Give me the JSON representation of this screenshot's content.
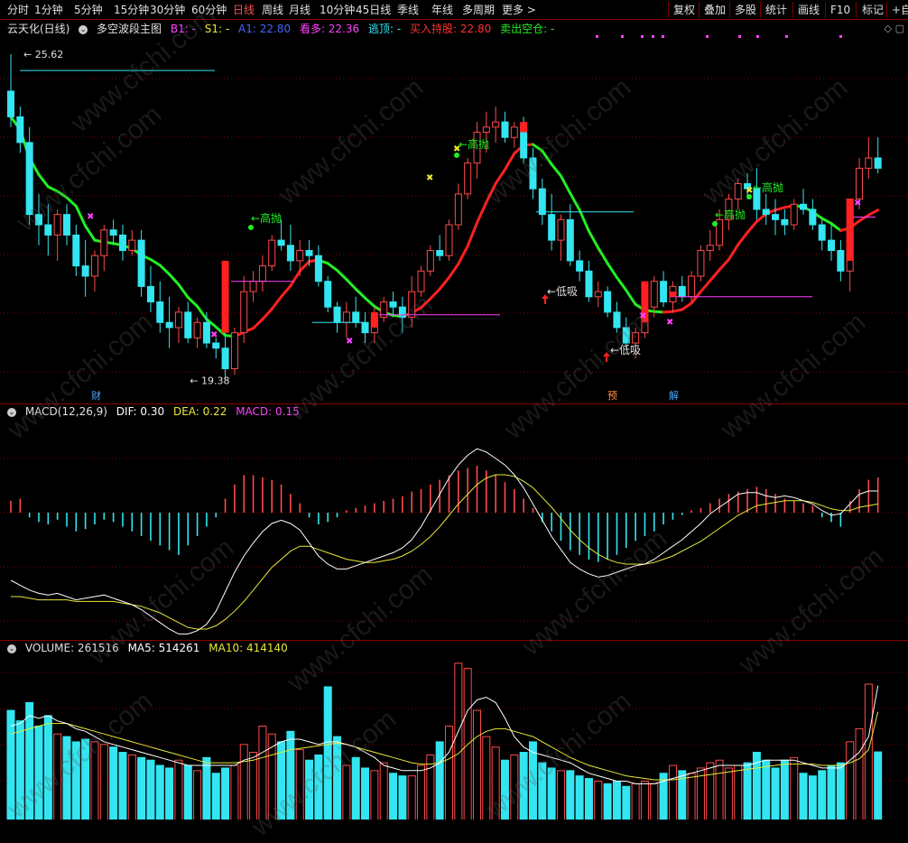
{
  "toolbar": {
    "periods": [
      "分时",
      "1分钟",
      "5分钟",
      "15分钟",
      "30分钟",
      "60分钟",
      "日线",
      "周线",
      "月线",
      "10分钟",
      "45日线",
      "季线",
      "年线",
      "多周期",
      "更多 >"
    ],
    "active_period": "日线",
    "tools": [
      "复权",
      "叠加",
      "多股",
      "统计",
      "画线",
      "F10",
      "标记",
      "+自选"
    ]
  },
  "main_header": {
    "title": "云天化(日线)",
    "indicator": "多空波段主图",
    "b1_label": "B1: -",
    "s1_label": "S1: -",
    "a1_label": "A1: 22.80",
    "kanduo_label": "看多: 22.36",
    "taoding_label": "逃顶: -",
    "buy_hold_label": "买入持股: 22.80",
    "sell_cash_label": "卖出空仓: -"
  },
  "price_labels": {
    "high": "25.62",
    "low": "19.38",
    "gaopao_1": "高抛",
    "gaopao_2": "高抛",
    "gaopao_3": "高抛",
    "gaopao_4": "高抛",
    "dixi_1": "低吸",
    "dixi_2": "低吸"
  },
  "event_markers": [
    "财",
    "预",
    "解"
  ],
  "macd_header": {
    "name": "MACD(12,26,9)",
    "dif": "DIF: 0.30",
    "dea": "DEA: 0.22",
    "macd": "MACD: 0.15"
  },
  "volume_header": {
    "name": "VOLUME: 261516",
    "ma5": "MA5: 514261",
    "ma10": "MA10: 414140"
  },
  "watermark": "www.cfchi.com",
  "colors": {
    "up": "#ff4a4a",
    "down": "#33e5f0",
    "ma_green": "#22ee22",
    "ma_red": "#ff2020",
    "dif": "#ffffff",
    "dea": "#e8e838",
    "macd_label": "#ff40ff",
    "grid": "#7a0000",
    "toolbar_active": "#ff5050"
  },
  "candles": [
    [
      24.9,
      25.62,
      24.2,
      24.4
    ],
    [
      24.4,
      24.6,
      23.7,
      23.9
    ],
    [
      23.9,
      24.2,
      22.3,
      22.5
    ],
    [
      22.5,
      22.9,
      21.9,
      22.3
    ],
    [
      22.3,
      22.7,
      21.7,
      22.1
    ],
    [
      22.1,
      22.6,
      21.6,
      22.5
    ],
    [
      22.5,
      22.7,
      21.9,
      22.1
    ],
    [
      22.1,
      22.3,
      21.3,
      21.5
    ],
    [
      21.5,
      22.0,
      20.9,
      21.3
    ],
    [
      21.3,
      21.8,
      21.0,
      21.7
    ],
    [
      21.7,
      22.3,
      21.4,
      22.2
    ],
    [
      22.2,
      22.4,
      21.9,
      22.1
    ],
    [
      22.1,
      22.3,
      21.6,
      21.8
    ],
    [
      21.8,
      22.2,
      21.7,
      22.0
    ],
    [
      22.0,
      22.2,
      20.9,
      21.1
    ],
    [
      21.1,
      21.5,
      20.6,
      20.8
    ],
    [
      20.8,
      21.2,
      20.2,
      20.4
    ],
    [
      20.4,
      20.9,
      19.9,
      20.3
    ],
    [
      20.3,
      20.7,
      20.0,
      20.6
    ],
    [
      20.6,
      20.8,
      20.0,
      20.1
    ],
    [
      20.1,
      20.5,
      19.9,
      20.4
    ],
    [
      20.4,
      20.6,
      19.9,
      20.0
    ],
    [
      20.0,
      20.1,
      19.7,
      19.9
    ],
    [
      19.9,
      20.2,
      19.3,
      19.5
    ],
    [
      19.5,
      20.3,
      19.38,
      20.2
    ],
    [
      20.2,
      21.3,
      20.0,
      21.0
    ],
    [
      21.0,
      21.4,
      20.8,
      21.2
    ],
    [
      21.2,
      21.7,
      21.0,
      21.5
    ],
    [
      21.5,
      22.1,
      21.4,
      22.0
    ],
    [
      22.0,
      22.4,
      21.8,
      21.9
    ],
    [
      21.9,
      22.3,
      21.4,
      21.6
    ],
    [
      21.6,
      22.0,
      21.3,
      21.8
    ],
    [
      21.8,
      22.0,
      21.5,
      21.7
    ],
    [
      21.7,
      21.9,
      21.1,
      21.2
    ],
    [
      21.2,
      21.3,
      20.6,
      20.7
    ],
    [
      20.7,
      20.8,
      20.2,
      20.4
    ],
    [
      20.4,
      20.8,
      20.1,
      20.6
    ],
    [
      20.6,
      20.9,
      20.3,
      20.4
    ],
    [
      20.4,
      20.6,
      20.0,
      20.2
    ],
    [
      20.2,
      20.7,
      20.0,
      20.5
    ],
    [
      20.5,
      20.9,
      20.4,
      20.8
    ],
    [
      20.8,
      21.0,
      20.5,
      20.7
    ],
    [
      20.7,
      20.9,
      20.2,
      20.5
    ],
    [
      20.5,
      21.3,
      20.3,
      21.0
    ],
    [
      21.0,
      21.5,
      20.9,
      21.4
    ],
    [
      21.4,
      21.9,
      21.3,
      21.8
    ],
    [
      21.8,
      22.1,
      21.6,
      21.7
    ],
    [
      21.7,
      22.4,
      21.6,
      22.3
    ],
    [
      22.3,
      23.1,
      22.2,
      22.9
    ],
    [
      22.9,
      23.6,
      22.8,
      23.5
    ],
    [
      23.5,
      24.3,
      23.2,
      24.1
    ],
    [
      24.1,
      24.5,
      23.7,
      24.2
    ],
    [
      24.2,
      24.6,
      23.9,
      24.3
    ],
    [
      24.3,
      24.5,
      23.9,
      24.0
    ],
    [
      24.0,
      24.3,
      23.8,
      24.2
    ],
    [
      24.2,
      24.4,
      23.5,
      23.6
    ],
    [
      23.6,
      23.8,
      22.8,
      23.0
    ],
    [
      23.0,
      23.2,
      22.3,
      22.5
    ],
    [
      22.5,
      22.9,
      21.8,
      22.0
    ],
    [
      22.0,
      22.5,
      21.6,
      22.4
    ],
    [
      22.4,
      22.7,
      21.5,
      21.6
    ],
    [
      21.6,
      21.8,
      21.2,
      21.4
    ],
    [
      21.4,
      21.6,
      20.8,
      20.9
    ],
    [
      20.9,
      21.2,
      20.7,
      21.0
    ],
    [
      21.0,
      21.1,
      20.5,
      20.6
    ],
    [
      20.6,
      20.8,
      20.2,
      20.3
    ],
    [
      20.3,
      20.5,
      19.9,
      20.0
    ],
    [
      20.0,
      20.3,
      19.7,
      20.2
    ],
    [
      20.2,
      20.8,
      20.1,
      20.7
    ],
    [
      20.7,
      21.3,
      20.5,
      21.2
    ],
    [
      21.2,
      21.4,
      20.7,
      20.8
    ],
    [
      20.8,
      21.2,
      20.6,
      21.1
    ],
    [
      21.1,
      21.3,
      20.8,
      20.9
    ],
    [
      20.9,
      21.4,
      20.8,
      21.3
    ],
    [
      21.3,
      21.9,
      21.2,
      21.8
    ],
    [
      21.8,
      22.2,
      21.6,
      21.9
    ],
    [
      21.9,
      22.6,
      21.8,
      22.4
    ],
    [
      22.4,
      22.9,
      22.2,
      22.8
    ],
    [
      22.8,
      23.2,
      22.6,
      23.1
    ],
    [
      23.1,
      23.3,
      22.8,
      23.0
    ],
    [
      23.0,
      23.4,
      22.4,
      22.6
    ],
    [
      22.6,
      22.9,
      22.3,
      22.5
    ],
    [
      22.5,
      22.8,
      22.1,
      22.4
    ],
    [
      22.4,
      22.6,
      22.1,
      22.3
    ],
    [
      22.3,
      22.8,
      22.2,
      22.7
    ],
    [
      22.7,
      23.0,
      22.5,
      22.6
    ],
    [
      22.6,
      22.8,
      22.2,
      22.3
    ],
    [
      22.3,
      22.4,
      21.8,
      22.0
    ],
    [
      22.0,
      22.3,
      21.6,
      21.8
    ],
    [
      21.8,
      22.0,
      21.2,
      21.4
    ],
    [
      21.4,
      22.8,
      21.0,
      22.8
    ],
    [
      22.8,
      23.6,
      22.6,
      23.4
    ],
    [
      23.4,
      24.0,
      23.2,
      23.6
    ],
    [
      23.6,
      24.0,
      23.3,
      23.4
    ]
  ],
  "macd_bars": [
    0.05,
    0.06,
    -0.02,
    -0.04,
    -0.05,
    -0.03,
    -0.06,
    -0.08,
    -0.07,
    -0.05,
    -0.03,
    -0.04,
    -0.06,
    -0.08,
    -0.1,
    -0.12,
    -0.14,
    -0.16,
    -0.18,
    -0.14,
    -0.1,
    -0.06,
    -0.02,
    0.06,
    0.12,
    0.16,
    0.16,
    0.15,
    0.14,
    0.12,
    0.08,
    0.04,
    -0.02,
    -0.05,
    -0.04,
    -0.02,
    0.01,
    0.02,
    0.03,
    0.04,
    0.05,
    0.06,
    0.07,
    0.09,
    0.1,
    0.12,
    0.14,
    0.16,
    0.18,
    0.19,
    0.2,
    0.18,
    0.16,
    0.13,
    0.1,
    0.06,
    0.02,
    -0.04,
    -0.08,
    -0.12,
    -0.16,
    -0.18,
    -0.2,
    -0.21,
    -0.2,
    -0.18,
    -0.15,
    -0.12,
    -0.1,
    -0.08,
    -0.05,
    -0.03,
    -0.01,
    0.01,
    0.02,
    0.04,
    0.06,
    0.08,
    0.09,
    0.1,
    0.11,
    0.1,
    0.08,
    0.06,
    0.05,
    0.04,
    0.03,
    -0.02,
    -0.04,
    -0.06,
    0.05,
    0.1,
    0.14,
    0.15
  ],
  "dif": [
    -0.25,
    -0.28,
    -0.31,
    -0.33,
    -0.34,
    -0.33,
    -0.35,
    -0.37,
    -0.36,
    -0.35,
    -0.34,
    -0.36,
    -0.38,
    -0.4,
    -0.43,
    -0.47,
    -0.51,
    -0.55,
    -0.58,
    -0.58,
    -0.56,
    -0.52,
    -0.44,
    -0.32,
    -0.2,
    -0.1,
    -0.02,
    0.05,
    0.1,
    0.12,
    0.1,
    0.06,
    -0.02,
    -0.1,
    -0.15,
    -0.18,
    -0.18,
    -0.16,
    -0.14,
    -0.12,
    -0.1,
    -0.08,
    -0.05,
    0.0,
    0.08,
    0.18,
    0.28,
    0.38,
    0.46,
    0.52,
    0.56,
    0.54,
    0.5,
    0.46,
    0.4,
    0.32,
    0.22,
    0.12,
    0.02,
    -0.06,
    -0.14,
    -0.18,
    -0.21,
    -0.23,
    -0.22,
    -0.2,
    -0.18,
    -0.16,
    -0.15,
    -0.12,
    -0.08,
    -0.04,
    0.0,
    0.05,
    0.1,
    0.16,
    0.2,
    0.24,
    0.28,
    0.29,
    0.29,
    0.27,
    0.26,
    0.27,
    0.26,
    0.24,
    0.22,
    0.18,
    0.15,
    0.16,
    0.22,
    0.28,
    0.3,
    0.3
  ],
  "dea": [
    -0.35,
    -0.35,
    -0.36,
    -0.37,
    -0.37,
    -0.37,
    -0.37,
    -0.38,
    -0.38,
    -0.38,
    -0.38,
    -0.38,
    -0.39,
    -0.4,
    -0.41,
    -0.43,
    -0.45,
    -0.48,
    -0.51,
    -0.54,
    -0.55,
    -0.55,
    -0.53,
    -0.49,
    -0.44,
    -0.38,
    -0.31,
    -0.24,
    -0.17,
    -0.12,
    -0.07,
    -0.04,
    -0.04,
    -0.06,
    -0.08,
    -0.1,
    -0.12,
    -0.13,
    -0.14,
    -0.14,
    -0.13,
    -0.12,
    -0.1,
    -0.07,
    -0.03,
    0.02,
    0.08,
    0.15,
    0.22,
    0.28,
    0.34,
    0.38,
    0.4,
    0.4,
    0.39,
    0.36,
    0.32,
    0.26,
    0.2,
    0.13,
    0.06,
    0.0,
    -0.05,
    -0.09,
    -0.12,
    -0.14,
    -0.15,
    -0.15,
    -0.15,
    -0.14,
    -0.12,
    -0.1,
    -0.07,
    -0.04,
    -0.01,
    0.03,
    0.07,
    0.11,
    0.15,
    0.18,
    0.21,
    0.22,
    0.23,
    0.24,
    0.24,
    0.24,
    0.23,
    0.21,
    0.19,
    0.18,
    0.18,
    0.2,
    0.21,
    0.22
  ],
  "volume": [
    420000,
    380000,
    450000,
    360000,
    400000,
    330000,
    320000,
    300000,
    310000,
    300000,
    290000,
    280000,
    260000,
    250000,
    240000,
    230000,
    210000,
    200000,
    230000,
    210000,
    190000,
    240000,
    180000,
    200000,
    210000,
    290000,
    260000,
    360000,
    330000,
    300000,
    340000,
    270000,
    230000,
    250000,
    510000,
    320000,
    210000,
    240000,
    200000,
    190000,
    220000,
    180000,
    170000,
    170000,
    210000,
    250000,
    300000,
    360000,
    600000,
    580000,
    420000,
    320000,
    280000,
    230000,
    250000,
    260000,
    300000,
    220000,
    200000,
    190000,
    190000,
    170000,
    160000,
    150000,
    140000,
    150000,
    130000,
    140000,
    150000,
    140000,
    180000,
    210000,
    190000,
    180000,
    200000,
    220000,
    230000,
    200000,
    210000,
    220000,
    260000,
    230000,
    200000,
    230000,
    240000,
    180000,
    170000,
    190000,
    210000,
    220000,
    300000,
    350000,
    520000,
    261516
  ],
  "ma5": [
    360000,
    370000,
    400000,
    390000,
    400000,
    380000,
    370000,
    350000,
    340000,
    320000,
    300000,
    290000,
    280000,
    270000,
    260000,
    250000,
    240000,
    230000,
    220000,
    210000,
    210000,
    210000,
    210000,
    210000,
    210000,
    230000,
    240000,
    260000,
    280000,
    300000,
    310000,
    310000,
    300000,
    290000,
    300000,
    300000,
    290000,
    280000,
    260000,
    240000,
    210000,
    200000,
    190000,
    190000,
    190000,
    200000,
    220000,
    260000,
    340000,
    420000,
    460000,
    470000,
    450000,
    390000,
    320000,
    280000,
    260000,
    250000,
    240000,
    230000,
    220000,
    200000,
    180000,
    170000,
    160000,
    150000,
    150000,
    140000,
    140000,
    140000,
    150000,
    160000,
    170000,
    180000,
    190000,
    200000,
    210000,
    210000,
    210000,
    210000,
    220000,
    230000,
    230000,
    230000,
    230000,
    220000,
    210000,
    200000,
    200000,
    200000,
    230000,
    260000,
    320000,
    514261
  ],
  "ma10": [
    330000,
    340000,
    350000,
    360000,
    370000,
    370000,
    370000,
    360000,
    350000,
    340000,
    330000,
    320000,
    310000,
    300000,
    290000,
    280000,
    270000,
    260000,
    250000,
    240000,
    230000,
    220000,
    220000,
    220000,
    220000,
    225000,
    230000,
    240000,
    250000,
    260000,
    270000,
    275000,
    280000,
    285000,
    290000,
    295000,
    290000,
    280000,
    270000,
    260000,
    250000,
    240000,
    230000,
    220000,
    215000,
    215000,
    220000,
    235000,
    255000,
    290000,
    320000,
    340000,
    350000,
    350000,
    340000,
    330000,
    320000,
    300000,
    280000,
    260000,
    240000,
    225000,
    210000,
    200000,
    190000,
    180000,
    170000,
    165000,
    160000,
    155000,
    155000,
    155000,
    160000,
    165000,
    170000,
    175000,
    180000,
    185000,
    190000,
    195000,
    200000,
    205000,
    210000,
    215000,
    215000,
    215000,
    215000,
    210000,
    210000,
    210000,
    220000,
    235000,
    270000,
    414140
  ]
}
